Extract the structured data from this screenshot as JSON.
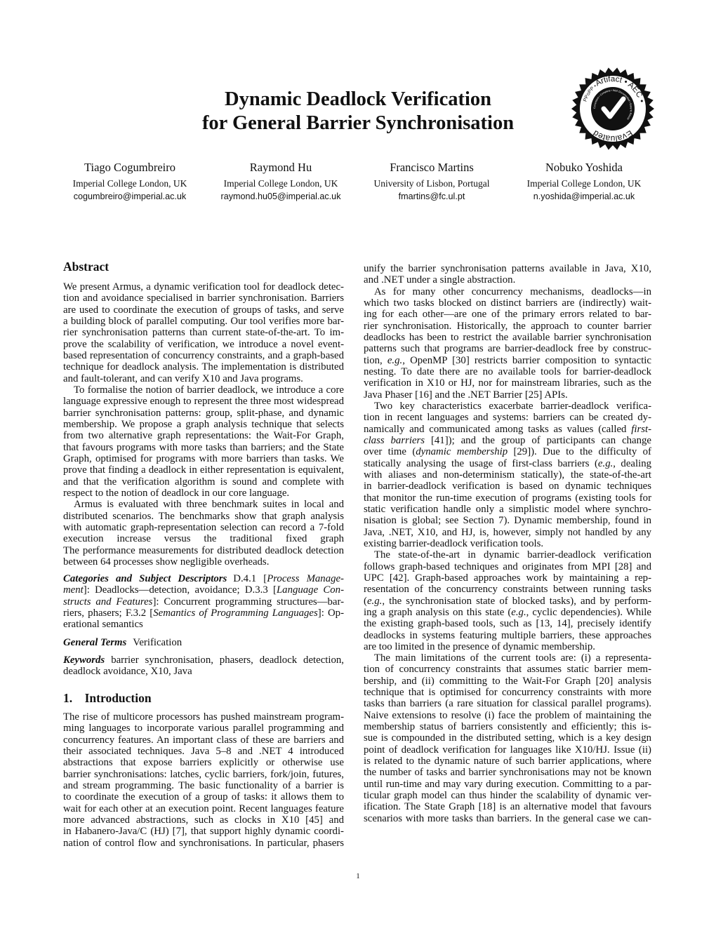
{
  "title": {
    "line1": "Dynamic Deadlock Verification",
    "line2": "for General Barrier Synchronisation"
  },
  "badge": {
    "top_text": "Artifact • AEC •",
    "bottom_text": "Evaluated",
    "left_text": "PPoPP •",
    "inner_text": "Consistent • Complete • Well Documented • Easy to Reuse",
    "icon": "check-icon"
  },
  "authors": [
    {
      "name": "Tiago Cogumbreiro",
      "affiliation": "Imperial College London, UK",
      "email": "cogumbreiro@imperial.ac.uk"
    },
    {
      "name": "Raymond Hu",
      "affiliation": "Imperial College London, UK",
      "email": "raymond.hu05@imperial.ac.uk"
    },
    {
      "name": "Francisco Martins",
      "affiliation": "University of Lisbon, Portugal",
      "email": "fmartins@fc.ul.pt"
    },
    {
      "name": "Nobuko Yoshida",
      "affiliation": "Imperial College London, UK",
      "email": "n.yoshida@imperial.ac.uk"
    }
  ],
  "abstract": {
    "heading": "Abstract",
    "paragraphs": [
      [
        "We present Armus, a dynamic verification tool for deadlock detec-",
        "tion and avoidance specialised in barrier synchronisation. Barriers",
        "are used to coordinate the execution of groups of tasks, and serve as",
        "a building block of parallel computing. Our tool verifies more bar-",
        "rier synchronisation patterns than current state-of-the-art. To im-",
        "prove the scalability of verification, we introduce a novel event-",
        "based representation of concurrency constraints, and a graph-based",
        "technique for deadlock analysis. The implementation is distributed",
        "and fault-tolerant, and can verify X10 and Java programs."
      ],
      [
        "To formalise the notion of barrier deadlock, we introduce a core",
        "language expressive enough to represent the three most widespread",
        "barrier synchronisation patterns: group, split-phase, and dynamic",
        "membership. We propose a graph analysis technique that selects",
        "from two alternative graph representations: the Wait-For Graph,",
        "that favours programs with more tasks than barriers; and the State",
        "Graph, optimised for programs with more barriers than tasks. We",
        "prove that finding a deadlock in either representation is equivalent,",
        "and that the verification algorithm is sound and complete with",
        "respect to the notion of deadlock in our core language."
      ],
      [
        "Armus is evaluated with three benchmark suites in local and",
        "distributed scenarios. The benchmarks show that graph analysis",
        "with automatic graph-representation selection can record a 7-fold",
        "execution increase versus the traditional fixed graph representation.",
        "The performance measurements for distributed deadlock detection",
        "between 64 processes show negligible overheads."
      ]
    ]
  },
  "categories": [
    [
      [
        {
          "t": "Categories and Subject Descriptors",
          "s": "bi",
          "g": 1
        },
        {
          "t": "D.4.1 [",
          "s": ""
        },
        {
          "t": "Process Manage-",
          "s": "i"
        }
      ],
      [
        {
          "t": "ment",
          "s": "i"
        },
        {
          "t": "]: Deadlocks—detection, avoidance;  D.3.3 [",
          "s": ""
        },
        {
          "t": "Language Con-",
          "s": "i"
        }
      ],
      [
        {
          "t": "structs and Features",
          "s": "i"
        },
        {
          "t": "]: Concurrent programming structures—bar-",
          "s": ""
        }
      ],
      [
        {
          "t": "riers, phasers;  F.3.2 [",
          "s": ""
        },
        {
          "t": "Semantics of Programming Languages",
          "s": "i"
        },
        {
          "t": "]: Op-",
          "s": ""
        }
      ],
      "erational semantics"
    ]
  ],
  "general_terms": [
    [
      [
        {
          "t": "General Terms",
          "s": "bi",
          "g": 1
        },
        {
          "t": "Verification",
          "s": ""
        }
      ]
    ]
  ],
  "keywords": [
    [
      [
        {
          "t": "Keywords",
          "s": "bi",
          "g": 1
        },
        {
          "t": "barrier synchronisation, phasers, deadlock detection,",
          "s": ""
        }
      ],
      "deadlock avoidance, X10, Java"
    ]
  ],
  "introduction": {
    "heading": "1.    Introduction",
    "paragraphs": [
      [
        "The rise of multicore processors has pushed mainstream program-",
        "ming languages to incorporate various parallel programming and",
        "concurrency features. An important class of these are barriers and",
        "their associated techniques. Java 5–8 and .NET 4 introduced several",
        "abstractions that expose barriers explicitly or otherwise use implicit",
        "barrier synchronisations: latches, cyclic barriers, fork/join, futures,",
        "and stream programming. The basic functionality of a barrier is",
        "to coordinate the execution of a group of tasks: it allows them to",
        "wait for each other at an execution point. Recent languages feature",
        "more advanced abstractions, such as clocks in X10 [45] and phasers",
        "in Habanero-Java/C (HJ) [7], that support highly dynamic coordi-",
        "nation of control flow and synchronisations. In particular, phasers"
      ]
    ],
    "continued_paragraphs": [
      [
        "unify the barrier synchronisation patterns available in Java, X10,",
        "and .NET under a single abstraction."
      ],
      [
        "As for many other concurrency mechanisms, deadlocks—in",
        "which two tasks blocked on distinct barriers are (indirectly) wait-",
        "ing for each other—are one of the primary errors related to bar-",
        "rier synchronisation. Historically, the approach to counter barrier",
        "deadlocks has been to restrict the available barrier synchronisation",
        "patterns such that programs are barrier-deadlock free by construc-",
        [
          {
            "t": "tion, ",
            "s": ""
          },
          {
            "t": "e.g.",
            "s": "i"
          },
          {
            "t": ", OpenMP [30] restricts barrier composition to syntactic",
            "s": ""
          }
        ],
        "nesting. To date there are no available tools for barrier-deadlock",
        "verification in X10 or HJ, nor for mainstream libraries, such as the",
        "Java Phaser [16] and the .NET Barrier [25] APIs."
      ],
      [
        "Two key characteristics exacerbate barrier-deadlock verifica-",
        "tion in recent languages and systems: barriers can be created dy-",
        [
          {
            "t": "namically and communicated among tasks as values (called ",
            "s": ""
          },
          {
            "t": "first-",
            "s": "i"
          }
        ],
        [
          {
            "t": "class barriers",
            "s": "i"
          },
          {
            "t": " [41]); and the group of participants can change",
            "s": ""
          }
        ],
        [
          {
            "t": "over time (",
            "s": ""
          },
          {
            "t": "dynamic membership",
            "s": "i"
          },
          {
            "t": " [29]). Due to the difficulty of",
            "s": ""
          }
        ],
        [
          {
            "t": "statically analysing the usage of first-class barriers (",
            "s": ""
          },
          {
            "t": "e.g.",
            "s": "i"
          },
          {
            "t": ", dealing",
            "s": ""
          }
        ],
        "with aliases and non-determinism statically), the state-of-the-art",
        "in barrier-deadlock verification is based on dynamic techniques",
        "that monitor the run-time execution of programs (existing tools for",
        "static verification handle only a simplistic model where synchro-",
        "nisation is global; see Section 7). Dynamic membership, found in",
        "Java, .NET, X10, and HJ, is, however, simply not handled by any",
        "existing barrier-deadlock verification tools."
      ],
      [
        "The state-of-the-art in dynamic barrier-deadlock verification",
        "follows graph-based techniques and originates from MPI [28] and",
        "UPC [42]. Graph-based approaches work by maintaining a rep-",
        "resentation of the concurrency constraints between running tasks",
        [
          {
            "t": "(",
            "s": ""
          },
          {
            "t": "e.g.",
            "s": "i"
          },
          {
            "t": ", the synchronisation state of blocked tasks), and by perform-",
            "s": ""
          }
        ],
        [
          {
            "t": "ing a graph analysis on this state (",
            "s": ""
          },
          {
            "t": "e.g.",
            "s": "i"
          },
          {
            "t": ", cyclic dependencies). While",
            "s": ""
          }
        ],
        "the existing graph-based tools, such as [13, 14], precisely identify",
        "deadlocks in systems featuring multiple barriers, these approaches",
        "are too limited in the presence of dynamic membership."
      ],
      [
        "The main limitations of the current tools are: (i) a representa-",
        "tion of concurrency constraints that assumes static barrier mem-",
        "bership, and (ii) committing to the Wait-For Graph [20] analysis",
        "technique that is optimised for concurrency constraints with more",
        "tasks than barriers (a rare situation for classical parallel programs).",
        "Naive extensions to resolve (i) face the problem of maintaining the",
        "membership status of barriers consistently and efficiently; this is-",
        "sue is compounded in the distributed setting, which is a key design",
        "point of deadlock verification for languages like X10/HJ. Issue (ii)",
        "is related to the dynamic nature of such barrier applications, where",
        "the number of tasks and barrier synchronisations may not be known",
        "until run-time and may vary during execution. Committing to a par-",
        "ticular graph model can thus hinder the scalability of dynamic ver-",
        "ification. The State Graph [18] is an alternative model that favours",
        "scenarios with more tasks than barriers. In the general case we can-"
      ]
    ]
  },
  "page_number": "1"
}
